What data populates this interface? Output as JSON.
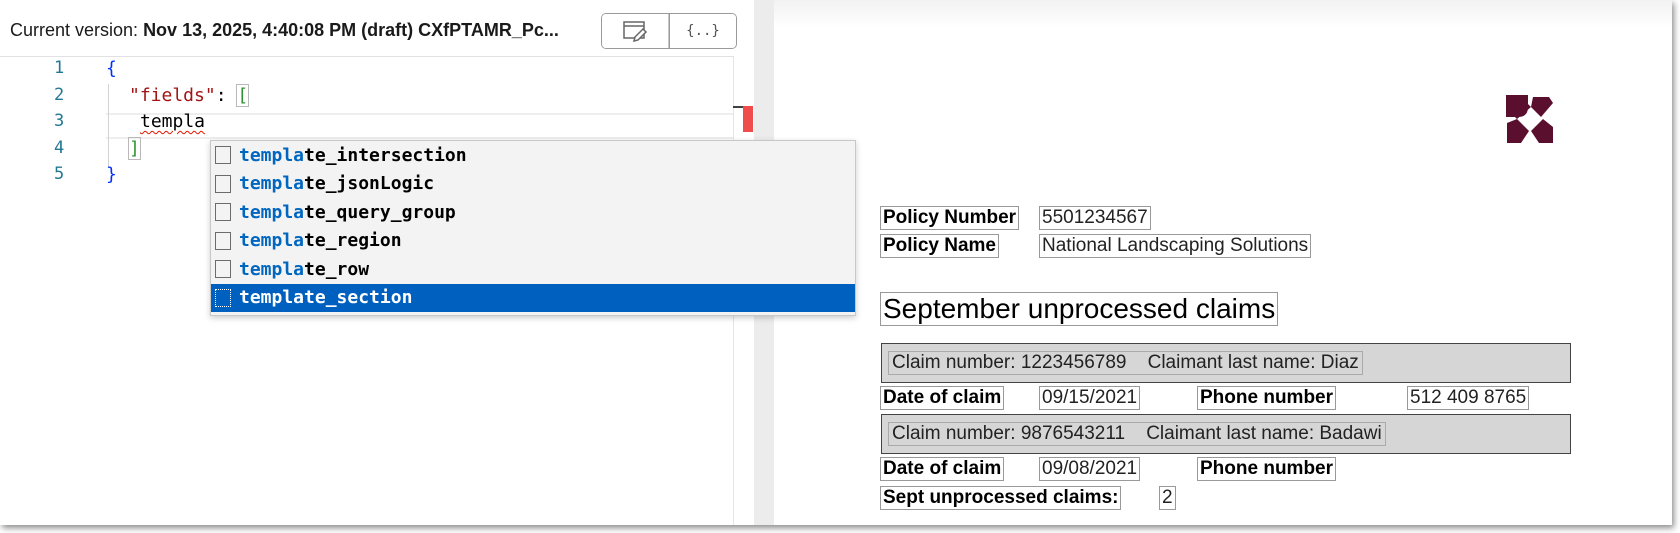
{
  "header": {
    "version_label": "Current version: ",
    "version_value": "Nov 13, 2025, 4:40:08 PM (draft) CXfPTAMR_Pc..."
  },
  "toolbar": {
    "preview_icon": "edit-window-icon",
    "json_icon": "curly-braces-icon",
    "json_label": "{..}"
  },
  "editor": {
    "line_numbers": [
      "1",
      "2",
      "3",
      "4",
      "5"
    ],
    "lines": {
      "l1": "{",
      "l2_key": "\"fields\"",
      "l2_colon": ": ",
      "l2_bracket": "[",
      "l3_text": "templa",
      "l4_bracket": "]",
      "l5": "}"
    }
  },
  "autocomplete": {
    "match": "templa",
    "items": [
      {
        "rest": "te_intersection",
        "selected": false
      },
      {
        "rest": "te_jsonLogic",
        "selected": false
      },
      {
        "rest": "te_query_group",
        "selected": false
      },
      {
        "rest": "te_region",
        "selected": false
      },
      {
        "rest": "te_row",
        "selected": false
      },
      {
        "rest": "te_section",
        "selected": true
      }
    ]
  },
  "preview": {
    "policy_number_label": "Policy Number",
    "policy_number_value": "5501234567",
    "policy_name_label": "Policy Name",
    "policy_name_value": "National Landscaping Solutions",
    "section_title": "September unprocessed claims",
    "claims": [
      {
        "header": "Claim number: 1223456789    Claimant last name: Diaz",
        "date_label": "Date of claim",
        "date_value": "09/15/2021",
        "phone_label": "Phone number",
        "phone_value": "512 409 8765"
      },
      {
        "header": "Claim number: 9876543211    Claimant last name: Badawi",
        "date_label": "Date of claim",
        "date_value": "09/08/2021",
        "phone_label": "Phone number",
        "phone_value": ""
      }
    ],
    "summary_label": "Sept unprocessed claims:",
    "summary_value": "2"
  },
  "colors": {
    "selection": "#0060c0",
    "match": "#0066bf",
    "logo": "#5a0f2f",
    "error": "#f14c4c"
  }
}
